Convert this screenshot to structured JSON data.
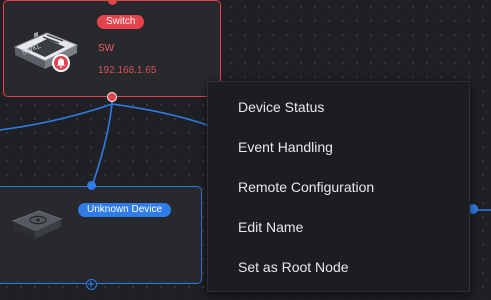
{
  "switch_node": {
    "badge": "Switch",
    "name": "SW",
    "ip": "192.168.1.65",
    "status_color": "#e5424d"
  },
  "unknown_node": {
    "badge": "Unknown Device",
    "status_color": "#2f7be8"
  },
  "context_menu": {
    "items": [
      {
        "label": "Device Status"
      },
      {
        "label": "Event Handling"
      },
      {
        "label": "Remote Configuration"
      },
      {
        "label": "Edit Name"
      },
      {
        "label": "Set as Root Node"
      }
    ]
  },
  "colors": {
    "background": "#1f2023",
    "alarm": "#e5424d",
    "link": "#2f7be8",
    "menu_background": "#1c1d21",
    "menu_text": "#e6e8eb"
  }
}
